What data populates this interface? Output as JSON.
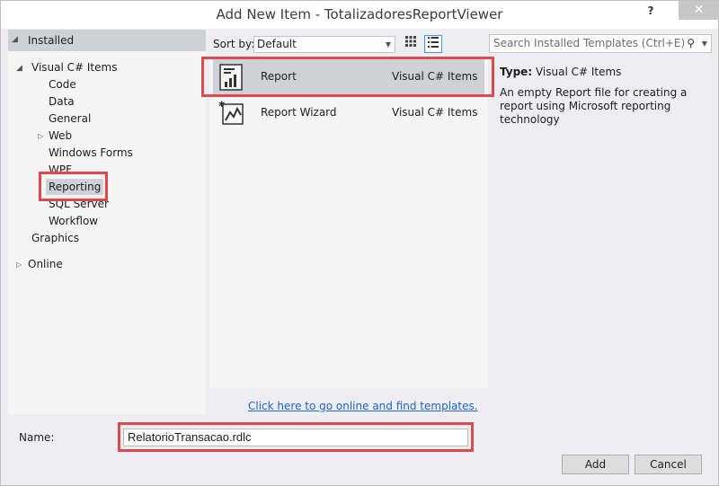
{
  "window": {
    "title": "Add New Item - TotalizadoresReportViewer",
    "help_label": "?",
    "close_label": "✕"
  },
  "tree": {
    "installed_label": "Installed",
    "visual_csharp_items": "Visual C# Items",
    "children": [
      "Code",
      "Data",
      "General",
      "Web",
      "Windows Forms",
      "WPF",
      "Reporting",
      "SQL Server",
      "Workflow"
    ],
    "graphics": "Graphics",
    "online": "Online",
    "selected": "Reporting"
  },
  "toolbar": {
    "sort_by_label": "Sort by:",
    "sort_value": "Default"
  },
  "search": {
    "placeholder": "Search Installed Templates (Ctrl+E)"
  },
  "templates": [
    {
      "name": "Report",
      "category": "Visual C# Items",
      "icon": "report-icon",
      "selected": true
    },
    {
      "name": "Report Wizard",
      "category": "Visual C# Items",
      "icon": "report-wizard-icon",
      "selected": false
    }
  ],
  "online_link": "Click here to go online and find templates.",
  "details": {
    "type_label": "Type:",
    "type_value": "Visual C# Items",
    "description": "An empty Report file for creating a report using Microsoft reporting technology"
  },
  "form": {
    "name_label": "Name:",
    "name_value": "RelatorioTransacao.rdlc"
  },
  "buttons": {
    "add": "Add",
    "cancel": "Cancel"
  },
  "colors": {
    "highlight": "#e0494c",
    "selection": "#cfd1d9",
    "link": "#1e64c8"
  }
}
